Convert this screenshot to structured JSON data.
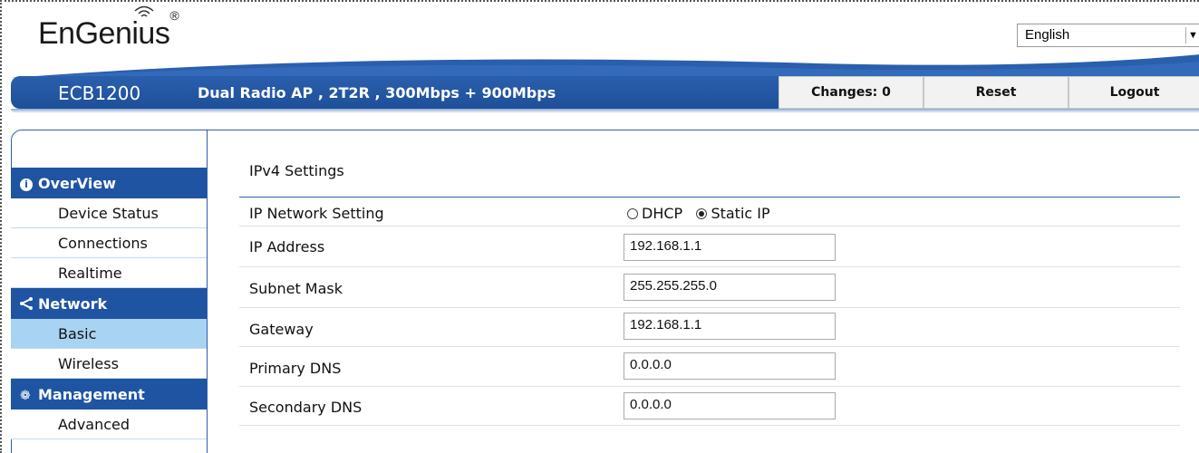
{
  "header": {
    "brand": "EnGenius",
    "brand_mark": "®",
    "language": "English",
    "model": "ECB1200",
    "description": "Dual Radio AP , 2T2R , 300Mbps + 900Mbps",
    "changes_label": "Changes: 0",
    "reset_label": "Reset",
    "logout_label": "Logout"
  },
  "sidebar": {
    "sections": [
      {
        "title": "OverView",
        "icon": "info-icon",
        "items": [
          "Device Status",
          "Connections",
          "Realtime"
        ]
      },
      {
        "title": "Network",
        "icon": "share-icon",
        "items": [
          "Basic",
          "Wireless"
        ]
      },
      {
        "title": "Management",
        "icon": "gear-icon",
        "items": [
          "Advanced"
        ]
      }
    ],
    "active_item": "Basic"
  },
  "main": {
    "section_title": "IPv4 Settings",
    "ip_network_setting_label": "IP Network Setting",
    "radio_dhcp": "DHCP",
    "radio_static": "Static IP",
    "selected_mode": "Static IP",
    "ip_address_label": "IP Address",
    "ip_address": "192.168.1.1",
    "subnet_mask_label": "Subnet Mask",
    "subnet_mask": "255.255.255.0",
    "gateway_label": "Gateway",
    "gateway": "192.168.1.1",
    "primary_dns_label": "Primary DNS",
    "primary_dns": "0.0.0.0",
    "secondary_dns_label": "Secondary DNS",
    "secondary_dns": "0.0.0.0"
  },
  "colors": {
    "brand_blue": "#1f54a3",
    "active_item": "#a9d3f2"
  }
}
